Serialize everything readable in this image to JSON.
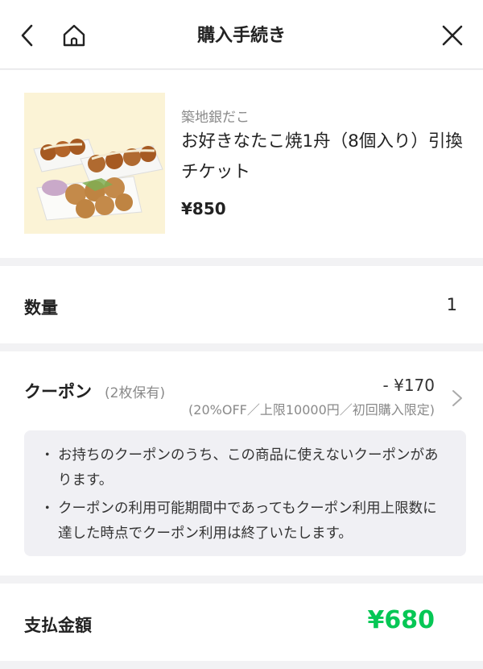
{
  "header": {
    "title": "購入手続き",
    "back_icon": "chevron-left-icon",
    "home_icon": "home-icon",
    "close_icon": "close-icon"
  },
  "product": {
    "shop": "築地銀だこ",
    "name": "お好きなたこ焼1舟（8個入り）引換チケット",
    "price": "¥850",
    "image": "takoyaki-photo"
  },
  "quantity": {
    "label": "数量",
    "value": "1"
  },
  "coupon": {
    "label": "クーポン",
    "count": "(2枚保有)",
    "discount": "- ¥170",
    "conditions": "(20%OFF／上限10000円／初回購入限定)",
    "notes": [
      "お持ちのクーポンのうち、この商品に使えないクーポンがあります。",
      "クーポンの利用可能期間中であってもクーポン利用上限数に達した時点でクーポン利用は終了いたします。"
    ]
  },
  "payment": {
    "label": "支払金額",
    "amount": "¥680",
    "accent_color": "#06c755"
  }
}
